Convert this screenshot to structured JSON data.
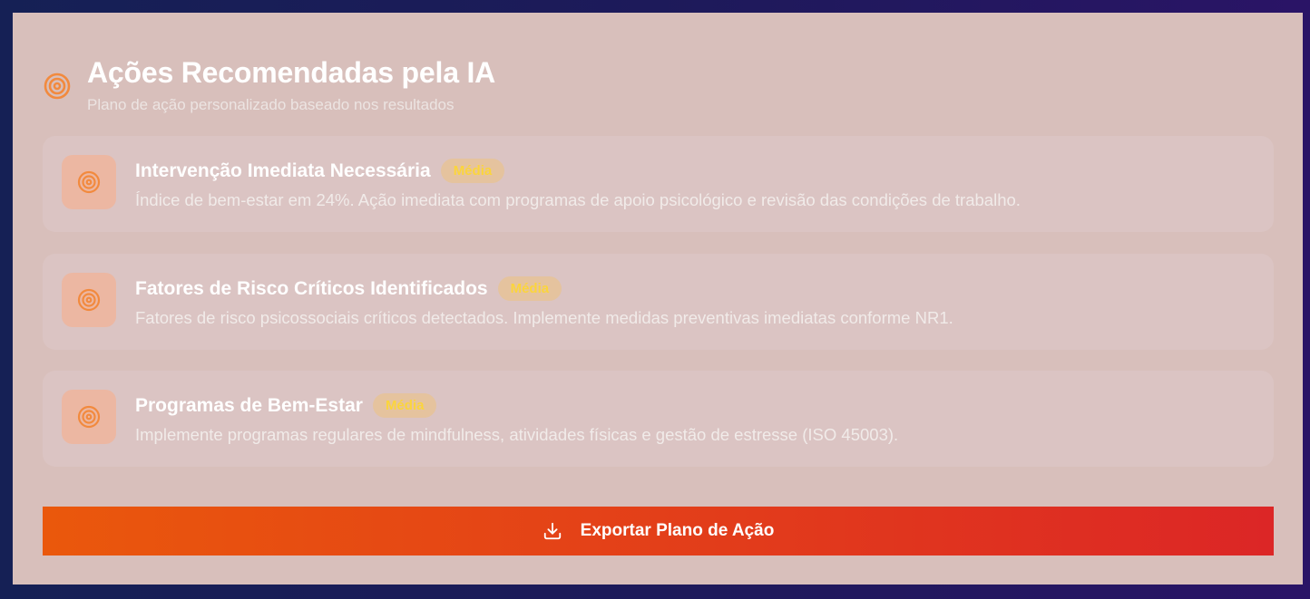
{
  "header": {
    "title": "Ações Recomendadas pela IA",
    "subtitle": "Plano de ação personalizado baseado nos resultados",
    "icon": "target-icon"
  },
  "actions": [
    {
      "title": "Intervenção Imediata Necessária",
      "badge": "Média",
      "description": "Índice de bem-estar em 24%. Ação imediata com programas de apoio psicológico e revisão das condições de trabalho.",
      "icon": "target-icon"
    },
    {
      "title": "Fatores de Risco Críticos Identificados",
      "badge": "Média",
      "description": "Fatores de risco psicossociais críticos detectados. Implemente medidas preventivas imediatas conforme NR1.",
      "icon": "target-icon"
    },
    {
      "title": "Programas de Bem-Estar",
      "badge": "Média",
      "description": "Implemente programas regulares de mindfulness, atividades físicas e gestão de estresse (ISO 45003).",
      "icon": "target-icon"
    }
  ],
  "export_button": {
    "label": "Exportar Plano de Ação",
    "icon": "download-icon"
  },
  "colors": {
    "accent_orange": "#ea580c",
    "accent_red": "#dc2626",
    "badge_text": "#fbd53c",
    "card_bg": "#d8bfbb"
  }
}
